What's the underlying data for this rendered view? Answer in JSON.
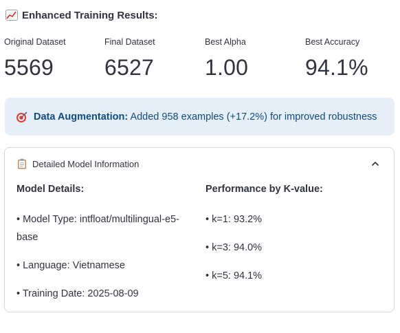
{
  "header": {
    "icon": "chart-increasing-icon",
    "title": "Enhanced Training Results:"
  },
  "metrics": [
    {
      "label": "Original Dataset",
      "value": "5569"
    },
    {
      "label": "Final Dataset",
      "value": "6527"
    },
    {
      "label": "Best Alpha",
      "value": "1.00"
    },
    {
      "label": "Best Accuracy",
      "value": "94.1%"
    }
  ],
  "info": {
    "icon": "bullseye-icon",
    "bold": "Data Augmentation:",
    "text": " Added 958 examples (+17.2%) for improved robustness",
    "background": "#e6eef8",
    "text_color": "#0f4c81"
  },
  "expander": {
    "icon": "clipboard-icon",
    "title": "Detailed Model Information",
    "state": "expanded",
    "left": {
      "heading": "Model Details:",
      "items": [
        "• Model Type: intfloat/multilingual-e5-base",
        "• Language: Vietnamese",
        "• Training Date: 2025-08-09"
      ]
    },
    "right": {
      "heading": "Performance by K-value:",
      "items": [
        "• k=1: 93.2%",
        "• k=3: 94.0%",
        "• k=5: 94.1%"
      ]
    }
  }
}
